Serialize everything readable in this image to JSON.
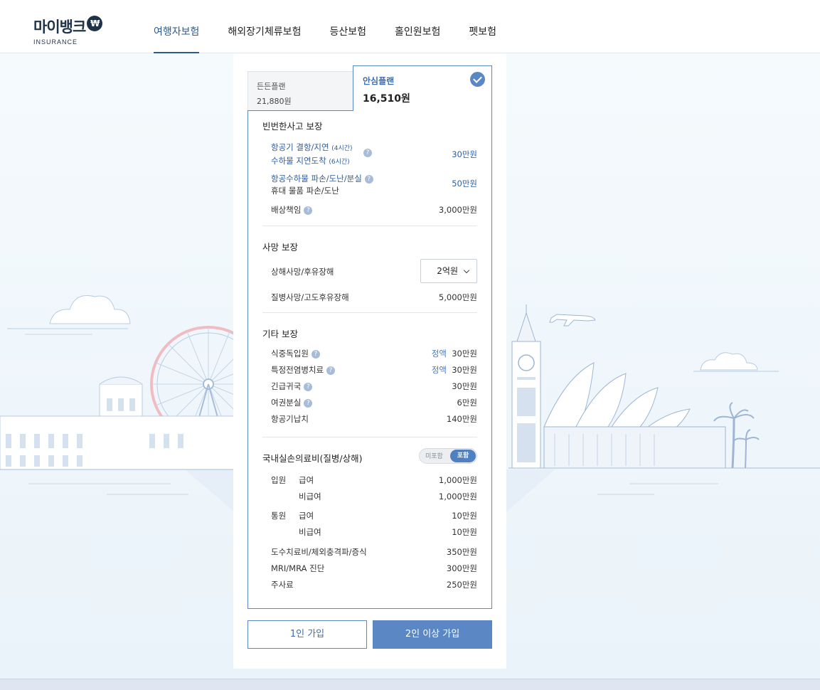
{
  "header": {
    "logo_main": "마이뱅크",
    "logo_coin": "₩",
    "logo_sub": "INSURANCE",
    "nav": [
      "여행자보험",
      "해외장기체류보험",
      "등산보험",
      "홀인원보험",
      "펫보험"
    ]
  },
  "plans": {
    "basic": {
      "name": "든든플랜",
      "price": "21,880원"
    },
    "safe": {
      "name": "안심플랜",
      "price": "16,510원"
    }
  },
  "sections": {
    "frequent": {
      "title": "빈번한사고 보장",
      "flight_delay_line1": "항공기 결항/지연",
      "flight_delay_note1": "(4시간)",
      "flight_delay_line2": "수하물 지연도착",
      "flight_delay_note2": "(6시간)",
      "flight_delay_amount": "30만원",
      "baggage_line1": "항공수하물 파손/도난/분실",
      "baggage_line2": "휴대 물품 파손/도난",
      "baggage_amount": "50만원",
      "liability_label": "배상책임",
      "liability_amount": "3,000만원"
    },
    "death": {
      "title": "사망 보장",
      "accident_label": "상해사망/후유장해",
      "accident_select": "2억원",
      "disease_label": "질병사망/고도후유장해",
      "disease_amount": "5,000만원"
    },
    "other": {
      "title": "기타 보장",
      "rows": [
        {
          "label": "식중독입원",
          "tag": "정액",
          "amount": "30만원"
        },
        {
          "label": "특정전염병치료",
          "tag": "정액",
          "amount": "30만원"
        },
        {
          "label": "긴급귀국",
          "tag": "",
          "amount": "30만원"
        },
        {
          "label": "여권분실",
          "tag": "",
          "amount": "6만원"
        },
        {
          "label": "항공기납치",
          "tag": "",
          "amount": "140만원"
        }
      ]
    },
    "medical": {
      "title": "국내실손의료비(질병/상해)",
      "toggle_off": "미포함",
      "toggle_on": "포함",
      "inpatient": "입원",
      "outpatient": "통원",
      "covered": "급여",
      "noncovered": "비급여",
      "inpatient_covered": "1,000만원",
      "inpatient_noncovered": "1,000만원",
      "outpatient_covered": "10만원",
      "outpatient_noncovered": "10만원",
      "extra": [
        {
          "label": "도수치료비/체외충격파/증식",
          "amount": "350만원"
        },
        {
          "label": "MRI/MRA 진단",
          "amount": "300만원"
        },
        {
          "label": "주사료",
          "amount": "250만원"
        }
      ]
    }
  },
  "buttons": {
    "one": "1인 가입",
    "two": "2인 이상 가입"
  },
  "colors": {
    "accent": "#5b88c4",
    "brand": "#1f3348",
    "background": "#f2f8fc"
  }
}
